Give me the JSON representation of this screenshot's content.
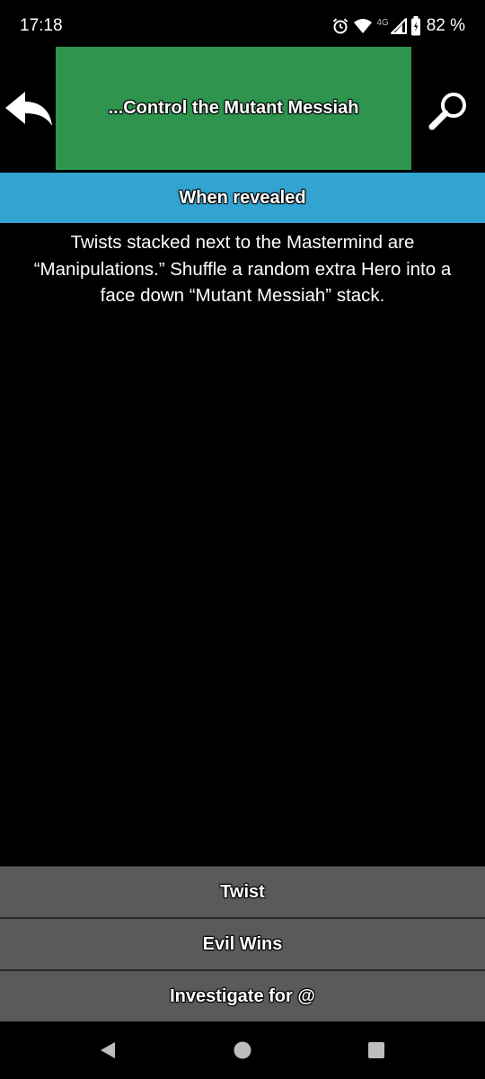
{
  "status_bar": {
    "time": "17:18",
    "network_label": "4G",
    "battery": "82 %"
  },
  "header": {
    "title": "...Control the Mutant Messiah",
    "back_icon": "back-arrow-icon",
    "search_icon": "search-icon"
  },
  "section": {
    "title": "When revealed",
    "description": "Twists stacked next to the Mastermind are “Manipulations.” Shuffle a random extra Hero into a face down “Mutant Messiah” stack."
  },
  "buttons": [
    {
      "label": "Twist"
    },
    {
      "label": "Evil Wins"
    },
    {
      "label": "Investigate for @"
    }
  ],
  "colors": {
    "title_bg": "#2e944e",
    "section_bg": "#33a3d1",
    "button_bg": "#5a5a5a",
    "background": "#000000"
  }
}
